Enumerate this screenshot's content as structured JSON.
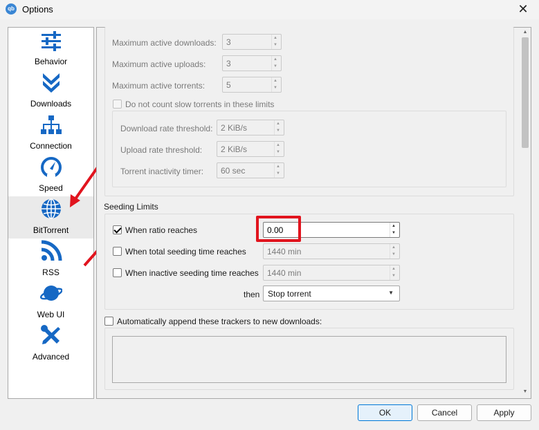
{
  "window": {
    "title": "Options",
    "app_icon_text": "qb",
    "close_glyph": "✕"
  },
  "sidebar": {
    "items": [
      {
        "label": "Behavior",
        "icon": "sliders-icon"
      },
      {
        "label": "Downloads",
        "icon": "double-chevron-down-icon"
      },
      {
        "label": "Connection",
        "icon": "network-icon"
      },
      {
        "label": "Speed",
        "icon": "speedometer-icon"
      },
      {
        "label": "BitTorrent",
        "icon": "globe-icon",
        "selected": true
      },
      {
        "label": "RSS",
        "icon": "rss-icon"
      },
      {
        "label": "Web UI",
        "icon": "planet-icon"
      },
      {
        "label": "Advanced",
        "icon": "tools-icon"
      }
    ]
  },
  "queue": {
    "max_downloads_label": "Maximum active downloads:",
    "max_downloads_value": "3",
    "max_uploads_label": "Maximum active uploads:",
    "max_uploads_value": "3",
    "max_torrents_label": "Maximum active torrents:",
    "max_torrents_value": "5",
    "slow_torrents_label": "Do not count slow torrents in these limits",
    "download_threshold_label": "Download rate threshold:",
    "download_threshold_value": "2 KiB/s",
    "upload_threshold_label": "Upload rate threshold:",
    "upload_threshold_value": "2 KiB/s",
    "inactivity_label": "Torrent inactivity timer:",
    "inactivity_value": "60 sec"
  },
  "seeding": {
    "section_title": "Seeding Limits",
    "ratio_label": "When ratio reaches",
    "ratio_value": "0.00",
    "ratio_checked": true,
    "seeding_time_label": "When total seeding time reaches",
    "seeding_time_value": "1440 min",
    "inactive_time_label": "When inactive seeding time reaches",
    "inactive_time_value": "1440 min",
    "then_label": "then",
    "action_value": "Stop torrent"
  },
  "trackers": {
    "append_label": "Automatically append these trackers to new downloads:"
  },
  "buttons": {
    "ok": "OK",
    "cancel": "Cancel",
    "apply": "Apply"
  },
  "colors": {
    "annotation_red": "#e1141e",
    "icon_blue": "#1668c4"
  }
}
